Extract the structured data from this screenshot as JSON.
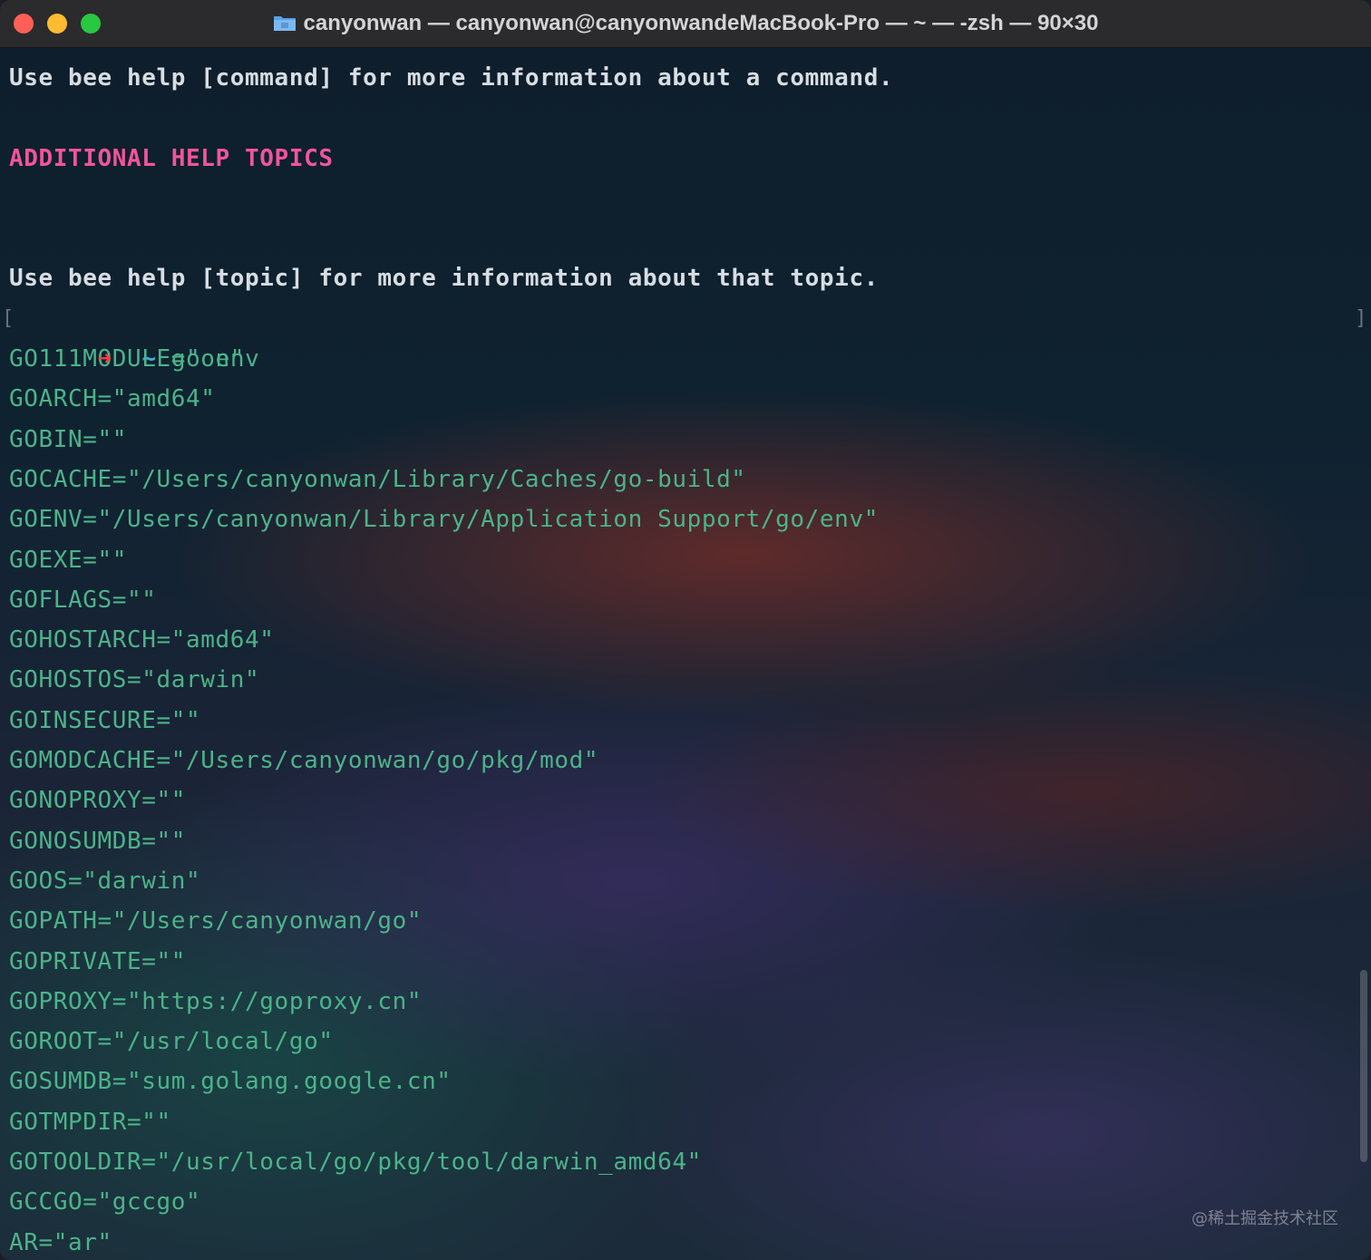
{
  "window": {
    "title": "canyonwan — canyonwan@canyonwandeMacBook-Pro — ~ — -zsh — 90×30"
  },
  "terminal": {
    "help_line_1": "Use bee help [command] for more information about a command.",
    "section_header": "ADDITIONAL HELP TOPICS",
    "help_line_2": "Use bee help [topic] for more information about that topic.",
    "prompt": {
      "arrow": "➜",
      "cwd": "~",
      "command": "go env"
    },
    "env_lines": [
      "GO111MODULE=\"on\"",
      "GOARCH=\"amd64\"",
      "GOBIN=\"\"",
      "GOCACHE=\"/Users/canyonwan/Library/Caches/go-build\"",
      "GOENV=\"/Users/canyonwan/Library/Application Support/go/env\"",
      "GOEXE=\"\"",
      "GOFLAGS=\"\"",
      "GOHOSTARCH=\"amd64\"",
      "GOHOSTOS=\"darwin\"",
      "GOINSECURE=\"\"",
      "GOMODCACHE=\"/Users/canyonwan/go/pkg/mod\"",
      "GONOPROXY=\"\"",
      "GONOSUMDB=\"\"",
      "GOOS=\"darwin\"",
      "GOPATH=\"/Users/canyonwan/go\"",
      "GOPRIVATE=\"\"",
      "GOPROXY=\"https://goproxy.cn\"",
      "GOROOT=\"/usr/local/go\"",
      "GOSUMDB=\"sum.golang.google.cn\"",
      "GOTMPDIR=\"\"",
      "GOTOOLDIR=\"/usr/local/go/pkg/tool/darwin_amd64\"",
      "GCCGO=\"gccgo\"",
      "AR=\"ar\""
    ]
  },
  "watermark": "@稀土掘金技术社区",
  "icons": {
    "folder": "folder-icon"
  },
  "colors": {
    "close": "#fe5f57",
    "minimize": "#febc2e",
    "maximize": "#28c840",
    "header": "#f0559b",
    "env_text": "#4cb389",
    "prompt_arrow": "#ff3b3b"
  }
}
